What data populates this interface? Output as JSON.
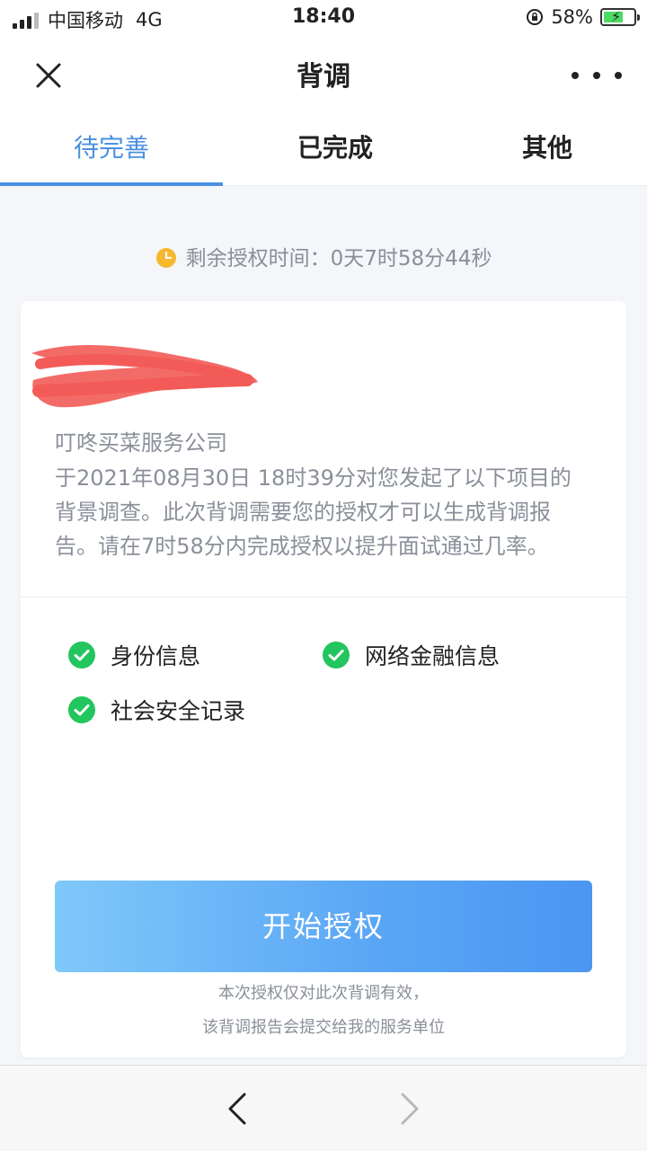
{
  "status_bar": {
    "carrier": "中国移动",
    "network": "4G",
    "time": "18:40",
    "battery": "58%"
  },
  "nav": {
    "title": "背调",
    "close_icon": "close-icon",
    "more_icon": "more-icon"
  },
  "tabs": [
    {
      "label": "待完善",
      "active": true
    },
    {
      "label": "已完成",
      "active": false
    },
    {
      "label": "其他",
      "active": false
    }
  ],
  "timer": {
    "label": "剩余授权时间：0天7时58分44秒",
    "icon": "clock-icon"
  },
  "card": {
    "company": "叮咚买菜服务公司",
    "desc_lines": [
      "于2021年08月30日 18时39分对您发起了以下项目的",
      "背景调查。此次背调需要您的授权才可以生成背调报",
      "告。请在7时58分内完成授权以提升面试通过几率。"
    ],
    "items": [
      {
        "label": "身份信息"
      },
      {
        "label": "网络金融信息"
      },
      {
        "label": "社会安全记录"
      }
    ],
    "button_label": "开始授权",
    "notes": [
      "本次授权仅对此次背调有效，",
      "该背调报告会提交给我的服务单位"
    ]
  },
  "colors": {
    "accent": "#4a90e2",
    "check": "#22c55e",
    "timer_icon": "#f5b82e",
    "redaction": "#f25b57"
  }
}
